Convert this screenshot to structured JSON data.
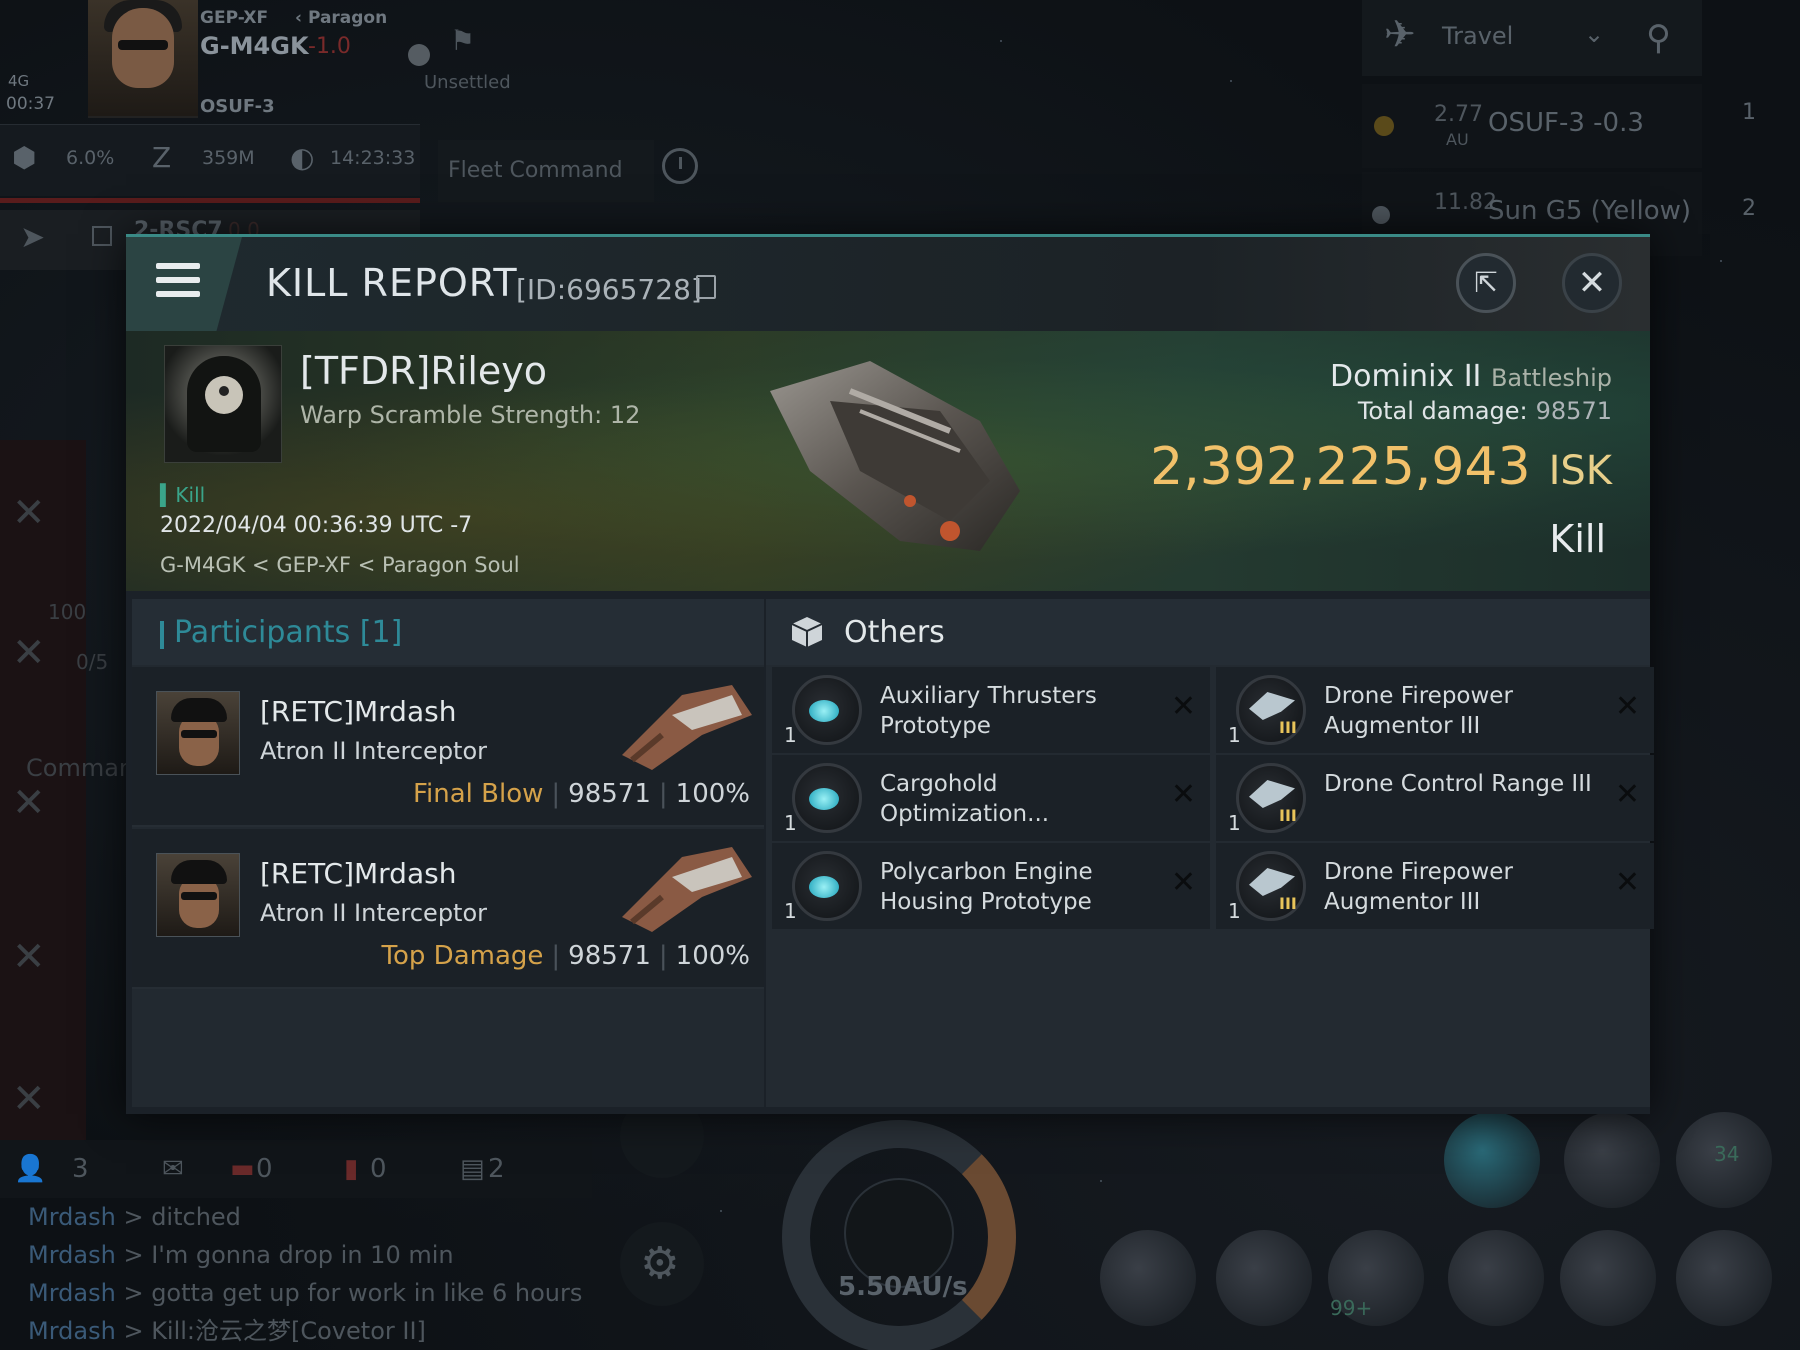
{
  "hud": {
    "signal": "4G",
    "time": "00:37",
    "region_path": "GEP-XF",
    "region_parent": "Paragon",
    "current_system": "G-M4GK",
    "current_security": "-1.0",
    "constellation_system": "OSUF-3",
    "sov_status": "Unsettled",
    "stat_cargo": "6.0%",
    "stat_sleep": "359M",
    "stat_clock": "14:23:33",
    "fleet_command": "Fleet Command",
    "route_next": "2-RSC7",
    "route_next_security": "0.0"
  },
  "travel": {
    "mode": "Travel",
    "destinations": [
      {
        "distance": "2.77",
        "unit": "AU",
        "name": "OSUF-3 -0.3",
        "side_num": "1"
      },
      {
        "distance": "11.82",
        "unit": "",
        "name": "Sun G5 (Yellow)",
        "side_num": "2"
      }
    ]
  },
  "left_panel": {
    "overview_count": "100",
    "count_fraction": "0/5",
    "label": "Comman"
  },
  "chat": {
    "tabs": {
      "people": "3",
      "red1": "0",
      "red2": "0",
      "msgs": "2"
    },
    "lines": [
      {
        "who": "Mrdash",
        "text": "ditched"
      },
      {
        "who": "Mrdash",
        "text": "I'm gonna drop in 10 min"
      },
      {
        "who": "Mrdash",
        "text": "gotta get up for work in like 6 hours"
      },
      {
        "who": "Mrdash",
        "text": "Kill:沧云之梦[Covetor II]"
      }
    ]
  },
  "hud_bottom": {
    "speed": "5.50AU/s",
    "module_badge": "99+",
    "drone_count": "34"
  },
  "kill_report": {
    "title": "KILL REPORT",
    "id": "[ID:6965728]",
    "victim": {
      "name": "[TFDR]Rileyo",
      "warp_scramble": "Warp Scramble Strength: 12"
    },
    "kill_tag": "Kill",
    "date": "2022/04/04 00:36:39 UTC -7",
    "location": "G-M4GK < GEP-XF < Paragon Soul",
    "ship": {
      "name": "Dominix II",
      "class": "Battleship"
    },
    "total_damage_label": "Total damage:",
    "total_damage": "98571",
    "isk_value": "2,392,225,943",
    "isk_unit": "ISK",
    "result": "Kill",
    "participants_title": "Participants",
    "participants_count": "[1]",
    "participants": [
      {
        "name": "[RETC]Mrdash",
        "ship": "Atron II Interceptor",
        "tag": "Final Blow",
        "damage": "98571",
        "percent": "100%"
      },
      {
        "name": "[RETC]Mrdash",
        "ship": "Atron II Interceptor",
        "tag": "Top Damage",
        "damage": "98571",
        "percent": "100%"
      }
    ],
    "others_title": "Others",
    "items": [
      {
        "qty": "1",
        "name": "Auxiliary Thrusters Prototype",
        "icon": "thruster-icon"
      },
      {
        "qty": "1",
        "name": "Drone Firepower Augmentor III",
        "icon": "drone-rig-icon"
      },
      {
        "qty": "1",
        "name": "Cargohold Optimization...",
        "icon": "thruster-icon"
      },
      {
        "qty": "1",
        "name": "Drone Control Range III",
        "icon": "drone-rig-icon"
      },
      {
        "qty": "1",
        "name": "Polycarbon Engine Housing Prototype",
        "icon": "thruster-icon"
      },
      {
        "qty": "1",
        "name": "Drone Firepower Augmentor III",
        "icon": "drone-rig-icon"
      }
    ]
  }
}
